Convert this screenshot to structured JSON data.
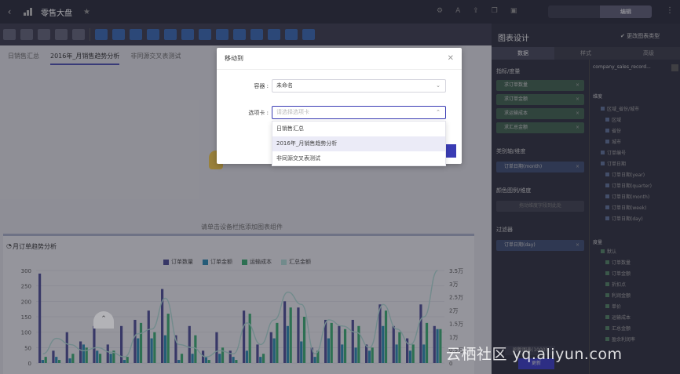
{
  "topbar": {
    "back_icon": "chevron-left-icon",
    "title": "零售大盘",
    "mode_tabs": [
      "",
      "编辑"
    ],
    "active_mode": 1
  },
  "canvas": {
    "tabs": [
      "日销售汇总",
      "2016年_月销售趋势分析",
      "非同源交叉表测试"
    ],
    "active_tab": 1,
    "placeholder_text": "请单击设备栏拖添加图表组件"
  },
  "chart": {
    "title": "月订单趋势分析"
  },
  "chart_data": {
    "type": "bar",
    "title": "月订单趋势分析",
    "legend": [
      "订单数量",
      "订单金额",
      "运输成本",
      "汇总金额"
    ],
    "colors": [
      "#4b4a8a",
      "#2f7fa3",
      "#3a9d6b",
      "#9fc4c0"
    ],
    "y_left_ticks": [
      "0",
      "50",
      "100",
      "150",
      "200",
      "250",
      "300"
    ],
    "y_right_ticks": [
      "0",
      "0.5万",
      "1万",
      "1.5万",
      "2万",
      "2.5万",
      "3万",
      "3.5万"
    ],
    "ylim": [
      0,
      300
    ],
    "series": [
      {
        "name": "订单数量",
        "values": [
          290,
          40,
          100,
          70,
          120,
          60,
          120,
          140,
          170,
          240,
          90,
          120,
          40,
          100,
          40,
          170,
          60,
          100,
          200,
          180,
          50,
          140,
          120,
          140,
          60,
          190,
          120,
          80,
          190,
          120
        ]
      },
      {
        "name": "订单金额",
        "values": [
          10,
          20,
          15,
          60,
          40,
          30,
          10,
          80,
          80,
          90,
          10,
          30,
          20,
          30,
          20,
          40,
          20,
          80,
          120,
          70,
          20,
          80,
          60,
          50,
          40,
          120,
          60,
          40,
          60,
          110
        ]
      },
      {
        "name": "运输成本",
        "values": [
          20,
          10,
          30,
          50,
          30,
          40,
          20,
          130,
          100,
          160,
          30,
          90,
          10,
          50,
          10,
          160,
          30,
          130,
          180,
          150,
          40,
          130,
          110,
          120,
          50,
          170,
          100,
          60,
          130,
          110
        ]
      }
    ],
    "line": {
      "name": "汇总金额",
      "values": [
        30,
        80,
        60,
        40,
        50,
        35,
        20,
        95,
        110,
        210,
        60,
        50,
        20,
        40,
        30,
        130,
        60,
        140,
        230,
        190,
        30,
        140,
        120,
        100,
        50,
        190,
        110,
        60,
        150,
        300
      ]
    }
  },
  "right_panel": {
    "title": "图表设计",
    "action": "更改图表类型",
    "tabs": [
      "数据",
      "样式",
      "高级"
    ],
    "active_tab": 0,
    "sections": {
      "metrics_label": "指标/度量",
      "metrics": [
        "求订单数量",
        "求订单金额",
        "求运输成本",
        "求汇总金额"
      ],
      "category_label": "类别轴/维度",
      "category": [
        "订单日期(month)"
      ],
      "color_label": "颜色图例/维度",
      "color_placeholder": "拖动维度字段到此处",
      "filter_label": "过滤器",
      "filter": [
        "订单日期(day)"
      ]
    },
    "dataset": "company_sales_record...",
    "dimension_group": "维度",
    "dimension_fields": [
      "区域_省份/城市",
      "区域",
      "省份",
      "城市",
      "订单编号",
      "订单日期",
      "订单日期(year)",
      "订单日期(quarter)",
      "订单日期(month)",
      "订单日期(week)",
      "订单日期(day)"
    ],
    "measure_group": "度量",
    "measure_fields": [
      "默认",
      "订单数量",
      "订单金额",
      "折扣点",
      "利润金额",
      "单价",
      "运输成本",
      "汇总金额",
      "盈余利润率"
    ],
    "bottom_buttons": [
      "刷新图表(1000)",
      "更新"
    ]
  },
  "modal": {
    "title": "移动到",
    "container_label": "容器 :",
    "container_value": "未命名",
    "tab_label": "选项卡 :",
    "tab_placeholder": "请选择选项卡",
    "options": [
      "日销售汇总",
      "2016年_月销售趋势分析",
      "非同源交叉表测试"
    ],
    "highlighted_option": 1
  },
  "watermark": "云栖社区 yq.aliyun.com"
}
